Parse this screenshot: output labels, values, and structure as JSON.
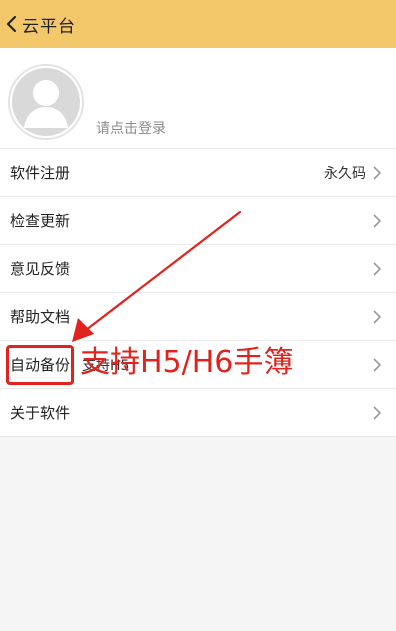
{
  "header": {
    "back_icon": "chevron-left-icon",
    "title": "云平台",
    "background": "#f3c86b"
  },
  "profile": {
    "avatar_icon": "default-avatar-icon",
    "login_prompt": "请点击登录"
  },
  "menu": {
    "items": [
      {
        "label": "软件注册",
        "value": "永久码"
      },
      {
        "label": "检查更新",
        "value": ""
      },
      {
        "label": "意见反馈",
        "value": ""
      },
      {
        "label": "帮助文档",
        "value": ""
      },
      {
        "label": "自动备份",
        "value": "支持H5"
      },
      {
        "label": "关于软件",
        "value": ""
      }
    ],
    "chevron_icon": "chevron-right-icon"
  },
  "annotation": {
    "text": "支持H5/H6手簿",
    "color": "#e0231f"
  }
}
